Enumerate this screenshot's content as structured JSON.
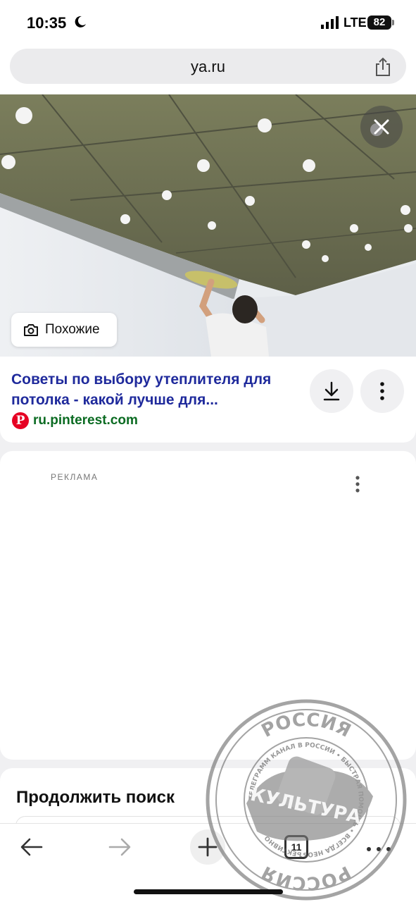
{
  "status_bar": {
    "time": "10:35",
    "network": "LTE",
    "battery": "82"
  },
  "address_bar": {
    "url": "ya.ru"
  },
  "image_viewer": {
    "similar_label": "Похожие"
  },
  "result": {
    "title": "Советы по выбору утеплителя для потолка - какой лучше для...",
    "source": "ru.pinterest.com",
    "source_icon_letter": "P",
    "source_color": "#0b6b22",
    "title_color": "#1f2a9c"
  },
  "ad": {
    "label": "РЕКЛАМА"
  },
  "continue_search": {
    "title": "Продолжить поиск"
  },
  "toolbar": {
    "tab_count": "11"
  },
  "watermark": {
    "top": "РОССИЯ",
    "center": "КУЛЬТУРА",
    "ring": "ТЕЛЕГРАММ КАНАЛ В РОССИИ • БЫСТРАЯ ПОМОЩЬ • ВСЕГДА НЕОБЪЕКТИВНО",
    "bottom": "РОССИЯ"
  }
}
